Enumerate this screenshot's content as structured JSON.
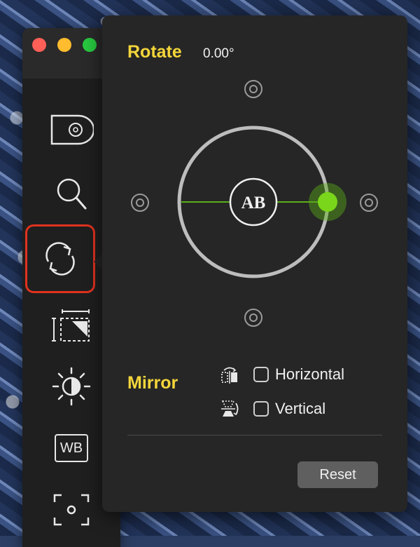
{
  "colors": {
    "accent": "#f4d63a",
    "knob": "#5cae1a",
    "selection_outline": "#e0321f"
  },
  "window": {
    "traffic_lights": [
      "close",
      "minimize",
      "zoom"
    ]
  },
  "sidebar": {
    "tools": [
      {
        "name": "disc-view-tool",
        "icon": "disc-icon",
        "selected": false
      },
      {
        "name": "zoom-tool",
        "icon": "magnifier-icon",
        "selected": false
      },
      {
        "name": "rotate-tool",
        "icon": "rotate-arrows-icon",
        "selected": true
      },
      {
        "name": "crop-tool",
        "icon": "crop-icon",
        "selected": false
      },
      {
        "name": "exposure-tool",
        "icon": "sun-contrast-icon",
        "selected": false
      },
      {
        "name": "white-balance-tool",
        "label": "WB",
        "selected": false
      },
      {
        "name": "focus-tool",
        "icon": "focus-frame-icon",
        "selected": false
      }
    ],
    "wb_label": "WB"
  },
  "rotate": {
    "title": "Rotate",
    "value": "0.00°",
    "dial_label": "AB",
    "angle_degrees": 0
  },
  "mirror": {
    "title": "Mirror",
    "horizontal": {
      "label": "Horizontal",
      "checked": false
    },
    "vertical": {
      "label": "Vertical",
      "checked": false
    }
  },
  "actions": {
    "reset_label": "Reset"
  }
}
